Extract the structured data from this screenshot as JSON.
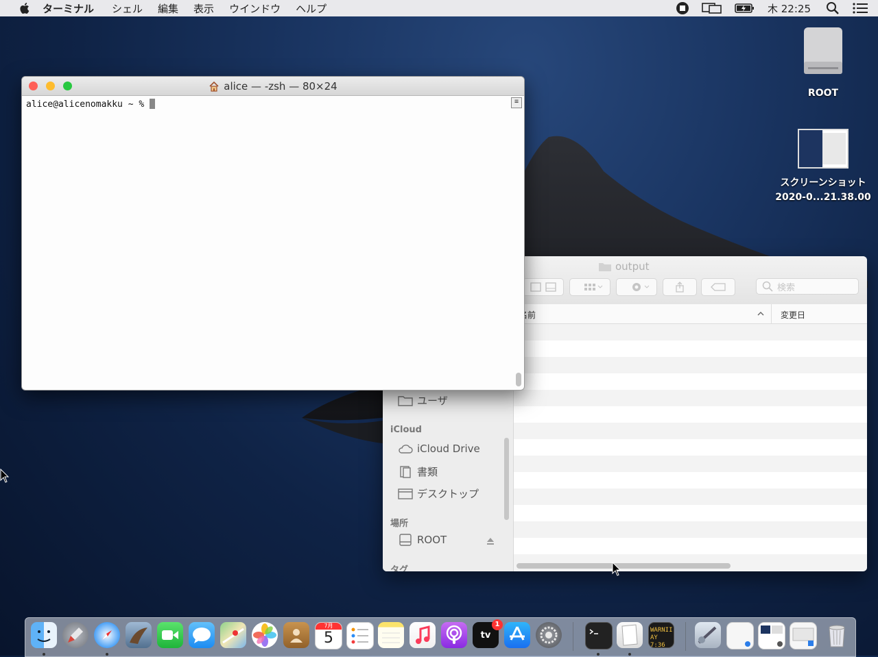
{
  "menubar": {
    "app_name": "ターミナル",
    "items": [
      "シェル",
      "編集",
      "表示",
      "ウインドウ",
      "ヘルプ"
    ],
    "clock": "木 22:25"
  },
  "desktop": {
    "drive_label": "ROOT",
    "screenshot_label_line1": "スクリーンショット",
    "screenshot_label_line2": "2020-0...21.38.00"
  },
  "terminal": {
    "title": "alice — -zsh — 80×24",
    "prompt": "alice@alicenomakku ~ % "
  },
  "finder": {
    "title": "output",
    "search_placeholder": "検索",
    "columns": {
      "name": "名前",
      "date": "変更日"
    },
    "sidebar": {
      "users_label": "ユーザ",
      "icloud_section": "iCloud",
      "icloud_drive": "iCloud Drive",
      "documents": "書類",
      "desktop": "デスクトップ",
      "places_section": "場所",
      "root": "ROOT",
      "tags_section": "タグ"
    }
  },
  "dock": {
    "calendar_day": "5",
    "calendar_month": "7月",
    "tv_label": "tv",
    "tv_badge": "1",
    "console_text_1": "WARNII",
    "console_text_2": "AY 7:36"
  },
  "colors": {
    "close": "#fe5f57",
    "minimize": "#febc2e",
    "zoom": "#28c840"
  }
}
